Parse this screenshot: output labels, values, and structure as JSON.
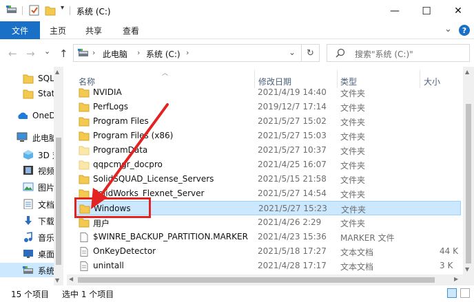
{
  "window": {
    "title": "系统 (C:)",
    "minimize": "—",
    "maximize": "☐",
    "close": "✕"
  },
  "ribbon": {
    "tabs": [
      "文件",
      "主页",
      "共享",
      "查看"
    ],
    "collapse": "⌄",
    "help": "?"
  },
  "nav": {
    "back": "←",
    "forward": "→",
    "recent": "⌄",
    "up": "↑",
    "breadcrumb": [
      "此电脑",
      "系统 (C:)"
    ],
    "dropdown": "⌄",
    "refresh": "↻"
  },
  "search": {
    "placeholder": "搜索\"系统 (C:)\""
  },
  "navpane": {
    "items": [
      {
        "label": "SQL",
        "icon": "folder-icon"
      },
      {
        "label": "Stat",
        "icon": "folder-icon"
      },
      {
        "label": "OneD",
        "icon": "cloud-icon"
      },
      {
        "label": "此电脑",
        "icon": "computer-icon"
      },
      {
        "label": "3D 对",
        "icon": "3d-objects-icon"
      },
      {
        "label": "视频",
        "icon": "video-icon"
      },
      {
        "label": "图片",
        "icon": "pictures-icon"
      },
      {
        "label": "文档",
        "icon": "documents-icon"
      },
      {
        "label": "下载",
        "icon": "download-icon"
      },
      {
        "label": "音乐",
        "icon": "music-icon"
      },
      {
        "label": "桌面",
        "icon": "desktop-icon"
      },
      {
        "label": "系统",
        "icon": "drive-icon"
      }
    ]
  },
  "columns": {
    "name": "名称",
    "date": "修改日期",
    "type": "类型",
    "size": "大小"
  },
  "files": [
    {
      "name": "NVIDIA",
      "date": "2021/4/19 14:40",
      "type": "文件夹",
      "size": "",
      "kind": "folder"
    },
    {
      "name": "PerfLogs",
      "date": "2019/12/7 17:14",
      "type": "文件夹",
      "size": "",
      "kind": "folder"
    },
    {
      "name": "Program Files",
      "date": "2021/5/27 15:02",
      "type": "文件夹",
      "size": "",
      "kind": "folder"
    },
    {
      "name": "Program Files (x86)",
      "date": "2021/5/27 15:03",
      "type": "文件夹",
      "size": "",
      "kind": "folder"
    },
    {
      "name": "ProgramData",
      "date": "2021/5/27 10:37",
      "type": "文件夹",
      "size": "",
      "kind": "folder-light"
    },
    {
      "name": "qqpcmgr_docpro",
      "date": "2021/4/25 16:07",
      "type": "文件夹",
      "size": "",
      "kind": "folder-light"
    },
    {
      "name": "SolidSQUAD_License_Servers",
      "date": "2021/5/15 21:58",
      "type": "文件夹",
      "size": "",
      "kind": "folder"
    },
    {
      "name": "SolidWorks_Flexnet_Server",
      "date": "2021/5/27 14:54",
      "type": "文件夹",
      "size": "",
      "kind": "folder"
    },
    {
      "name": "Windows",
      "date": "2021/5/27 15:23",
      "type": "文件夹",
      "size": "",
      "kind": "folder",
      "selected": true
    },
    {
      "name": "用户",
      "date": "2021/4/26 2:29",
      "type": "文件夹",
      "size": "",
      "kind": "folder"
    },
    {
      "name": "$WINRE_BACKUP_PARTITION.MARKER",
      "date": "2021/4/23 15:36",
      "type": "MARKER 文件",
      "size": "",
      "kind": "file"
    },
    {
      "name": "OnKeyDetector",
      "date": "2021/5/18 17:27",
      "type": "文本文档",
      "size": "44 K",
      "kind": "file"
    },
    {
      "name": "unintall",
      "date": "2021/4/28 17:17",
      "type": "文本文档",
      "size": "3 K",
      "kind": "file"
    }
  ],
  "status": {
    "count": "15 个项目",
    "selected": "选中 1 个项目"
  },
  "colors": {
    "accent": "#1a70c7",
    "selection": "#cce8ff",
    "annotation": "#e32222"
  }
}
